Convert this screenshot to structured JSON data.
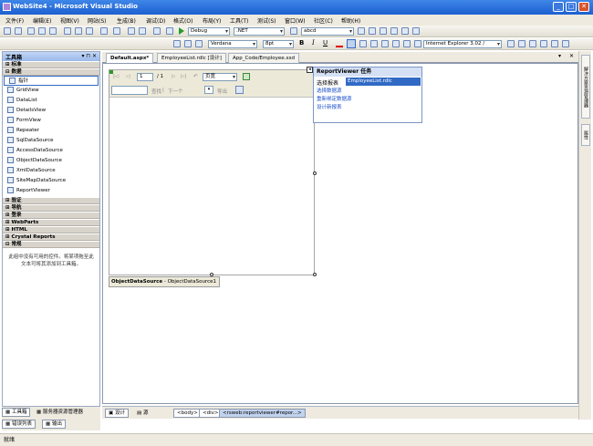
{
  "window": {
    "title": "WebSite4 - Microsoft Visual Studio"
  },
  "menu": [
    "文件(F)",
    "编辑(E)",
    "视图(V)",
    "网站(S)",
    "生成(B)",
    "调试(D)",
    "格式(O)",
    "布局(Y)",
    "工具(T)",
    "测试(S)",
    "窗口(W)",
    "社区(C)",
    "帮助(H)"
  ],
  "toolbar1": {
    "config": "Debug",
    "platform": ".NET",
    "find": "abcd"
  },
  "toolbar2": {
    "font": "Verdana",
    "size": "8pt",
    "bold": "B",
    "italic": "I",
    "underline": "U",
    "target": "Internet Explorer 3.02 /"
  },
  "toolbox": {
    "title": "工具箱",
    "controls": "▾ ⊓ ✕",
    "sections_top": [
      "标准",
      "数据"
    ],
    "items": [
      "指针",
      "GridView",
      "DataList",
      "DetailsView",
      "FormView",
      "Repeater",
      "SqlDataSource",
      "AccessDataSource",
      "ObjectDataSource",
      "XmlDataSource",
      "SiteMapDataSource",
      "ReportViewer"
    ],
    "sections_bottom": [
      "验证",
      "导航",
      "登录",
      "WebParts",
      "HTML",
      "Crystal Reports",
      "常规"
    ],
    "note": "此组中没有可用的控件。将某项拖至此文本可将其添加到工具箱。"
  },
  "tabs": [
    "Default.aspx*",
    "EmployeeList.rdlc [设计]",
    "App_Code/Employee.xsd"
  ],
  "reportviewer": {
    "page_input": "1",
    "page_of": "/ 1",
    "zoom": "页宽",
    "find_label": "查找",
    "next_label": "下一个",
    "export_label": "导出"
  },
  "tasks": {
    "title": "ReportViewer 任务",
    "choose_label": "选择报表",
    "choose_value": "EmployeeList.rdlc",
    "links": [
      "选择数据源",
      "重新绑定数据源",
      "设计新报表"
    ]
  },
  "ods": {
    "name": "ObjectDataSource",
    "id": "ObjectDataSource1"
  },
  "bottom": {
    "design": "设计",
    "source": "源",
    "crumbs": [
      "<body>",
      "<div>",
      "<rsweb:reportviewer#repor...>"
    ]
  },
  "panes": {
    "toolbox": "工具箱",
    "server": "服务器资源管理器",
    "errors": "错误列表",
    "output": "输出"
  },
  "right_tabs": [
    "解决方案资源管理器",
    "属性"
  ],
  "status": "就绪"
}
